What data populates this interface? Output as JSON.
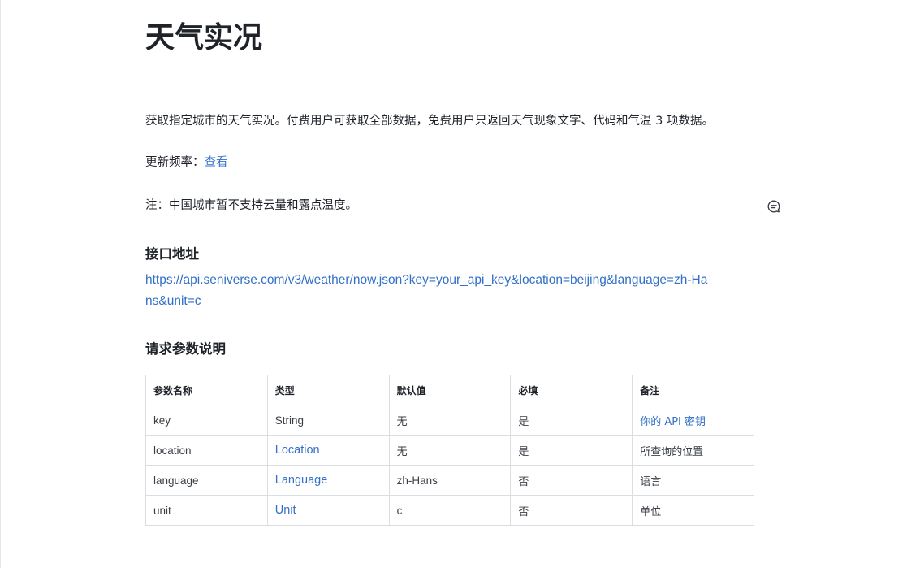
{
  "page": {
    "title": "天气实况",
    "description": "获取指定城市的天气实况。付费用户可获取全部数据，免费用户只返回天气现象文字、代码和气温 3 项数据。",
    "update_freq_label": "更新频率：",
    "update_freq_link": "查看",
    "note": "注：中国城市暂不支持云量和露点温度。"
  },
  "endpoint": {
    "heading": "接口地址",
    "url": "https://api.seniverse.com/v3/weather/now.json?key=your_api_key&location=beijing&language=zh-Hans&unit=c"
  },
  "params": {
    "heading": "请求参数说明",
    "headers": [
      "参数名称",
      "类型",
      "默认值",
      "必填",
      "备注"
    ],
    "rows": [
      {
        "name": "key",
        "type": "String",
        "default": "无",
        "required": "是",
        "note": "你的 API 密钥"
      },
      {
        "name": "location",
        "type": "Location",
        "default": "无",
        "required": "是",
        "note": "所查询的位置"
      },
      {
        "name": "language",
        "type": "Language",
        "default": "zh-Hans",
        "required": "否",
        "note": "语言"
      },
      {
        "name": "unit",
        "type": "Unit",
        "default": "c",
        "required": "否",
        "note": "单位"
      }
    ]
  },
  "icons": {
    "comment": "comment-icon"
  },
  "colors": {
    "link": "#3370c7",
    "text": "#1f2329",
    "border": "#dadde2"
  }
}
